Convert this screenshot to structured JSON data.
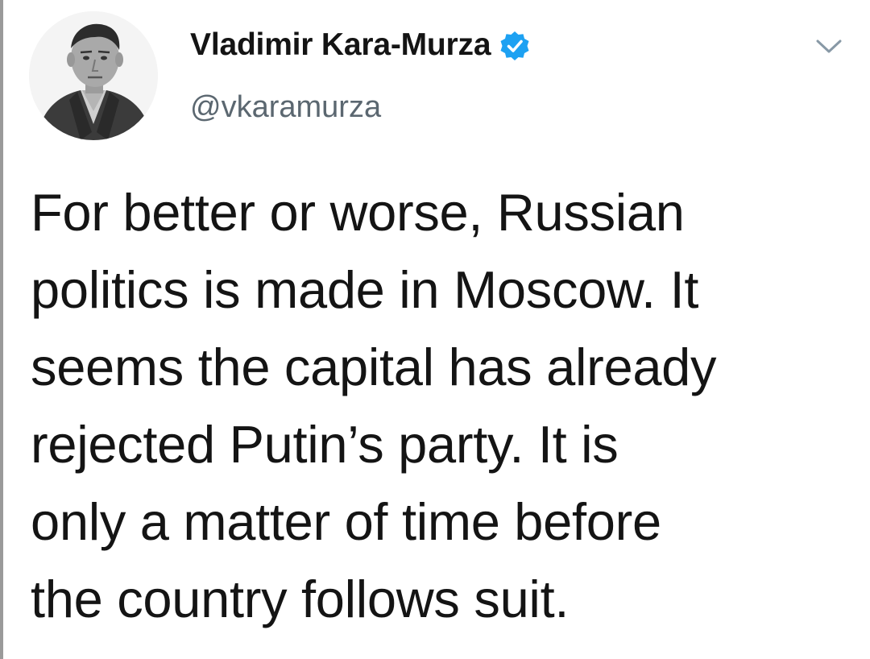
{
  "tweet": {
    "author": {
      "display_name": "Vladimir Kara-Murza",
      "handle": "@vkaramurza",
      "verified": true,
      "avatar_icon": "profile-photo",
      "verified_icon": "verified-badge-icon"
    },
    "menu_icon": "chevron-down-icon",
    "text": "For better or worse, Russian\npolitics is made in Moscow. It\nseems the capital has already\nrejected Putin’s party. It is\nonly a matter of time before\nthe country follows suit."
  },
  "colors": {
    "text": "#141414",
    "secondary_text": "#5b6770",
    "verified_blue": "#1da1f2",
    "chevron": "#8899a6",
    "background": "#ffffff"
  }
}
